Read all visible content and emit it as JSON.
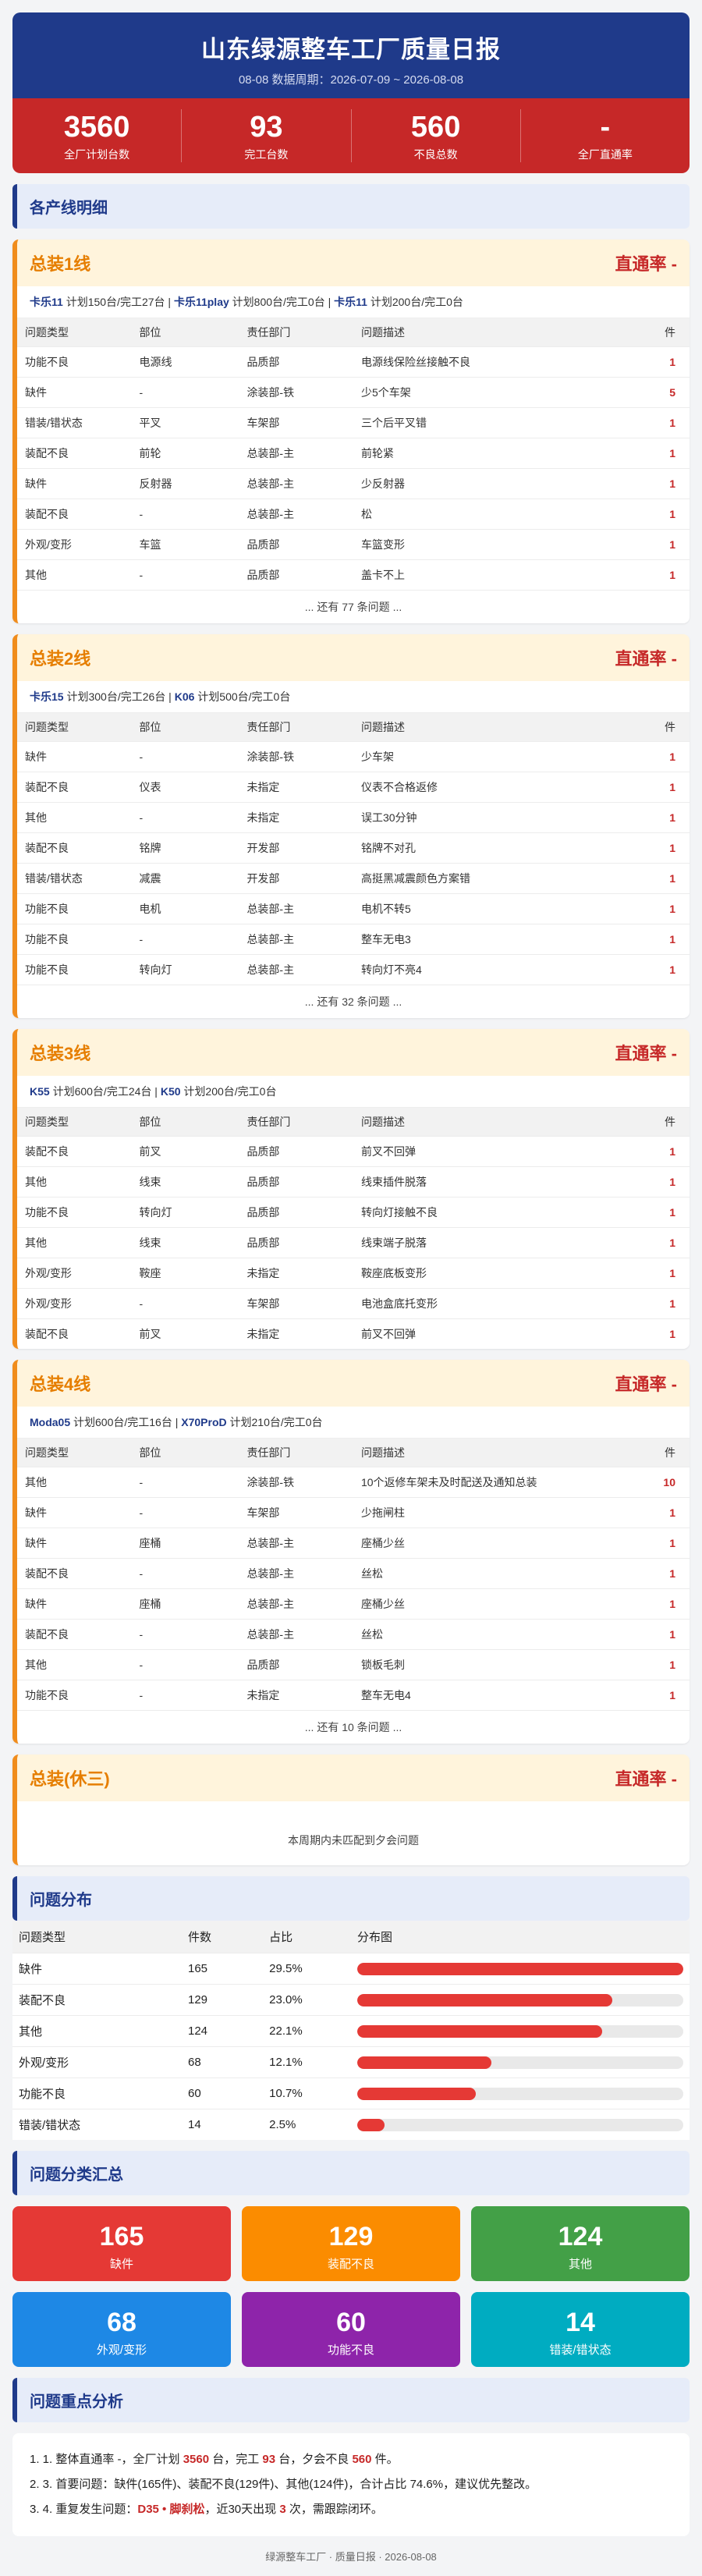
{
  "header": {
    "title": "山东绿源整车工厂质量日报",
    "subtitle": "08-08 数据周期：2026-07-09 ~ 2026-08-08"
  },
  "kpis": [
    {
      "value": "3560",
      "label": "全厂计划台数"
    },
    {
      "value": "93",
      "label": "完工台数"
    },
    {
      "value": "560",
      "label": "不良总数"
    },
    {
      "value": "-",
      "label": "全厂直通率"
    }
  ],
  "section_lines": "各产线明细",
  "columns": {
    "type": "问题类型",
    "part": "部位",
    "dept": "责任部门",
    "desc": "问题描述",
    "count": "件"
  },
  "lines": [
    {
      "name": "总装1线",
      "rate": "直通率 -",
      "products": [
        {
          "model": "卡乐11",
          "info": " 计划150台/完工27台"
        },
        {
          "model": "卡乐11play",
          "info": " 计划800台/完工0台"
        },
        {
          "model": "卡乐11",
          "info": " 计划200台/完工0台"
        }
      ],
      "issues": [
        [
          "功能不良",
          "电源线",
          "品质部",
          "电源线保险丝接触不良",
          "1"
        ],
        [
          "缺件",
          "-",
          "涂装部-铁",
          "少5个车架",
          "5"
        ],
        [
          "错装/错状态",
          "平叉",
          "车架部",
          "三个后平叉错",
          "1"
        ],
        [
          "装配不良",
          "前轮",
          "总装部-主",
          "前轮紧",
          "1"
        ],
        [
          "缺件",
          "反射器",
          "总装部-主",
          "少反射器",
          "1"
        ],
        [
          "装配不良",
          "-",
          "总装部-主",
          "松",
          "1"
        ],
        [
          "外观/变形",
          "车篮",
          "品质部",
          "车篮变形",
          "1"
        ],
        [
          "其他",
          "-",
          "品质部",
          "盖卡不上",
          "1"
        ]
      ],
      "more": "... 还有 77 条问题 ..."
    },
    {
      "name": "总装2线",
      "rate": "直通率 -",
      "products": [
        {
          "model": "卡乐15",
          "info": " 计划300台/完工26台"
        },
        {
          "model": "K06",
          "info": " 计划500台/完工0台"
        }
      ],
      "issues": [
        [
          "缺件",
          "-",
          "涂装部-铁",
          "少车架",
          "1"
        ],
        [
          "装配不良",
          "仪表",
          "未指定",
          "仪表不合格返修",
          "1"
        ],
        [
          "其他",
          "-",
          "未指定",
          "误工30分钟",
          "1"
        ],
        [
          "装配不良",
          "铭牌",
          "开发部",
          "铭牌不对孔",
          "1"
        ],
        [
          "错装/错状态",
          "减震",
          "开发部",
          "高挺黑减震颜色方案错",
          "1"
        ],
        [
          "功能不良",
          "电机",
          "总装部-主",
          "电机不转5",
          "1"
        ],
        [
          "功能不良",
          "-",
          "总装部-主",
          "整车无电3",
          "1"
        ],
        [
          "功能不良",
          "转向灯",
          "总装部-主",
          "转向灯不亮4",
          "1"
        ]
      ],
      "more": "... 还有 32 条问题 ..."
    },
    {
      "name": "总装3线",
      "rate": "直通率 -",
      "products": [
        {
          "model": "K55",
          "info": " 计划600台/完工24台"
        },
        {
          "model": "K50",
          "info": " 计划200台/完工0台"
        }
      ],
      "issues": [
        [
          "装配不良",
          "前叉",
          "品质部",
          "前叉不回弹",
          "1"
        ],
        [
          "其他",
          "线束",
          "品质部",
          "线束插件脱落",
          "1"
        ],
        [
          "功能不良",
          "转向灯",
          "品质部",
          "转向灯接触不良",
          "1"
        ],
        [
          "其他",
          "线束",
          "品质部",
          "线束端子脱落",
          "1"
        ],
        [
          "外观/变形",
          "鞍座",
          "未指定",
          "鞍座底板变形",
          "1"
        ],
        [
          "外观/变形",
          "-",
          "车架部",
          "电池盒底托变形",
          "1"
        ],
        [
          "装配不良",
          "前叉",
          "未指定",
          "前叉不回弹",
          "1"
        ]
      ],
      "more": ""
    },
    {
      "name": "总装4线",
      "rate": "直通率 -",
      "products": [
        {
          "model": "Moda05",
          "info": " 计划600台/完工16台"
        },
        {
          "model": "X70ProD",
          "info": " 计划210台/完工0台"
        }
      ],
      "issues": [
        [
          "其他",
          "-",
          "涂装部-铁",
          "10个返修车架未及时配送及通知总装",
          "10"
        ],
        [
          "缺件",
          "-",
          "车架部",
          "少拖闸柱",
          "1"
        ],
        [
          "缺件",
          "座桶",
          "总装部-主",
          "座桶少丝",
          "1"
        ],
        [
          "装配不良",
          "-",
          "总装部-主",
          "丝松",
          "1"
        ],
        [
          "缺件",
          "座桶",
          "总装部-主",
          "座桶少丝",
          "1"
        ],
        [
          "装配不良",
          "-",
          "总装部-主",
          "丝松",
          "1"
        ],
        [
          "其他",
          "-",
          "品质部",
          "锁板毛刺",
          "1"
        ],
        [
          "功能不良",
          "-",
          "未指定",
          "整车无电4",
          "1"
        ]
      ],
      "more": "... 还有 10 条问题 ..."
    },
    {
      "name": "总装(休三)",
      "rate": "直通率 -",
      "products": [],
      "issues": [],
      "more": "",
      "empty": "本周期内未匹配到夕会问题"
    }
  ],
  "section_dist": "问题分布",
  "chart_data": {
    "type": "table",
    "columns": [
      "问题类型",
      "件数",
      "占比",
      "分布图"
    ],
    "rows": [
      {
        "type": "缺件",
        "count": 165,
        "pct": "29.5%"
      },
      {
        "type": "装配不良",
        "count": 129,
        "pct": "23.0%"
      },
      {
        "type": "其他",
        "count": 124,
        "pct": "22.1%"
      },
      {
        "type": "外观/变形",
        "count": 68,
        "pct": "12.1%"
      },
      {
        "type": "功能不良",
        "count": 60,
        "pct": "10.7%"
      },
      {
        "type": "错装/错状态",
        "count": 14,
        "pct": "2.5%"
      }
    ]
  },
  "section_cards": "问题分类汇总",
  "cards": [
    {
      "value": "165",
      "label": "缺件",
      "color": "#e53935"
    },
    {
      "value": "129",
      "label": "装配不良",
      "color": "#fb8c00"
    },
    {
      "value": "124",
      "label": "其他",
      "color": "#43a047"
    },
    {
      "value": "68",
      "label": "外观/变形",
      "color": "#1e88e5"
    },
    {
      "value": "60",
      "label": "功能不良",
      "color": "#8e24aa"
    },
    {
      "value": "14",
      "label": "错装/错状态",
      "color": "#00acc1"
    }
  ],
  "section_analysis": "问题重点分析",
  "analysis": [
    {
      "parts": [
        {
          "t": "1. 1. 整体直通率 -，全厂计划 "
        },
        {
          "t": "3560",
          "hl": 1
        },
        {
          "t": " 台，完工 "
        },
        {
          "t": "93",
          "hl": 1
        },
        {
          "t": " 台，夕会不良 "
        },
        {
          "t": "560",
          "hl": 1
        },
        {
          "t": " 件。"
        }
      ]
    },
    {
      "parts": [
        {
          "t": "2. 3. 首要问题：缺件(165件)、装配不良(129件)、其他(124件)，合计占比 74.6%，建议优先整改。"
        }
      ]
    },
    {
      "parts": [
        {
          "t": "3. 4. 重复发生问题："
        },
        {
          "t": "D35 • 脚刹松",
          "hl": 1
        },
        {
          "t": "，近30天出现 "
        },
        {
          "t": "3",
          "hl": 1
        },
        {
          "t": " 次，需跟踪闭环。"
        }
      ]
    }
  ],
  "footer": "绿源整车工厂 · 质量日报 · 2026-08-08"
}
